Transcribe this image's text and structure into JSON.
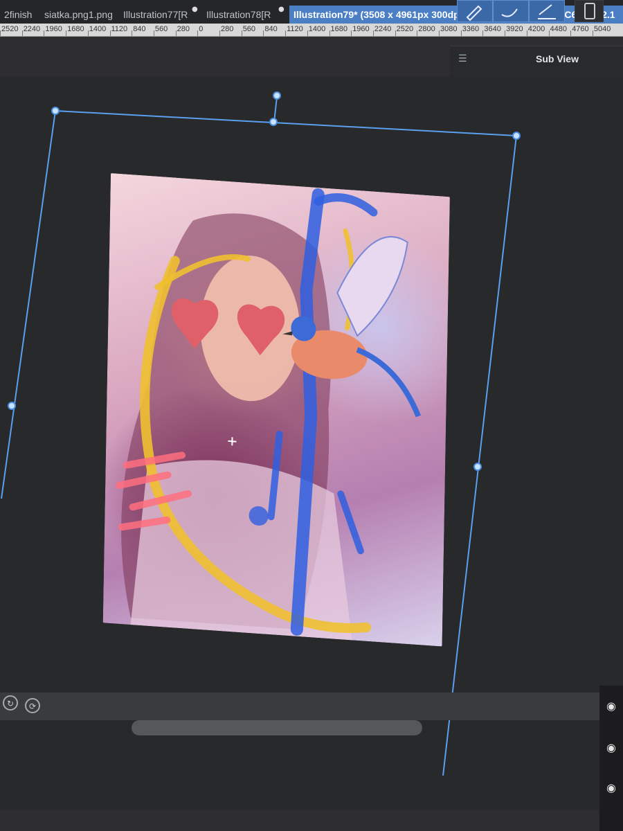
{
  "tabs": [
    {
      "label": "2finish"
    },
    {
      "label": "siatka.png1.png"
    },
    {
      "label": "Illustration77[R"
    },
    {
      "label": "Illustration78[R"
    }
  ],
  "active_tab": {
    "label": "Illustration79* (3508 x 4961px 300dpi 18.3% : RGB:sRGB IEC61966-2.1"
  },
  "ruler": {
    "ticks": [
      "2520",
      "2240",
      "1960",
      "1680",
      "1400",
      "1120",
      "840",
      "560",
      "280",
      "0",
      "280",
      "560",
      "840",
      "1120",
      "1400",
      "1680",
      "1960",
      "2240",
      "2520",
      "2800",
      "3080",
      "3360",
      "3640",
      "3920",
      "4200",
      "4480",
      "4760",
      "5040"
    ]
  },
  "subview": {
    "title": "Sub View",
    "menu_icon": "menu-icon"
  },
  "colors": {
    "accent": "#4b7fc4",
    "handle_line": "#5aa0f0",
    "canvas_bg": "#28292b"
  },
  "icons": {
    "tool1": "pen-icon",
    "tool2": "brush-icon",
    "tool3": "marker-icon",
    "device": "device-icon",
    "rotate": "rotate-icon",
    "reset": "reset-icon",
    "visibility": "eye-icon"
  }
}
